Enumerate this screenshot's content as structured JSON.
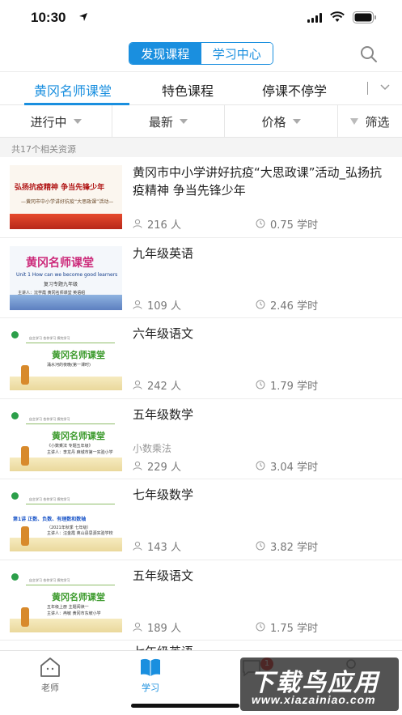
{
  "status_bar": {
    "time": "10:30"
  },
  "header": {
    "segments": [
      "发现课程",
      "学习中心"
    ],
    "active_segment": 0
  },
  "category_tabs": [
    "黄冈名师课堂",
    "特色课程",
    "停课不停学"
  ],
  "filters": {
    "status": "进行中",
    "sort": "最新",
    "price": "价格",
    "filter": "筛选"
  },
  "result_count": "共17个相关资源",
  "courses": [
    {
      "title": "黄冈市中小学讲好抗疫“大思政课”活动_弘扬抗疫精神 争当先锋少年",
      "subtitle": "",
      "learners": "216 人",
      "hours": "0.75 学时",
      "thumb": {
        "main": "弘扬抗疫精神 争当先锋少年",
        "sub": "—黄冈市中小学讲好抗疫“大思政课”活动—"
      }
    },
    {
      "title": "九年级英语",
      "subtitle": "",
      "learners": "109 人",
      "hours": "2.46 学时",
      "thumb": {
        "main": "黄冈名师课堂",
        "line1": "Unit 1  How can we  become good learners",
        "line2": "复习专题九年级",
        "line3": "主讲人：沈学霞  黄冈名师课堂 英语组"
      }
    },
    {
      "title": "六年级语文",
      "subtitle": "",
      "learners": "242 人",
      "hours": "1.79 学时",
      "thumb": {
        "top": "自主学习    合作学习    探究学习",
        "main": "黄冈名师课堂",
        "line": "涌水河的夜晚(第一课时)",
        "line2": ""
      }
    },
    {
      "title": "五年级数学",
      "subtitle": "小数乘法",
      "learners": "229 人",
      "hours": "3.04 学时",
      "thumb": {
        "top": "自主学习    合作学习    探究学习",
        "main": "黄冈名师课堂",
        "line": "《小数乘法   专题五年级》",
        "line2": "主讲人：李龙丹   麻城市第一实验小学"
      }
    },
    {
      "title": "七年级数学",
      "subtitle": "",
      "learners": "143 人",
      "hours": "3.82 学时",
      "thumb": {
        "top": "自主学习    合作学习    探究学习",
        "main": "",
        "lecture": "第1讲  正数、负数、有理数和数轴",
        "line": "（2021年秋季  七年级）",
        "line2": "主讲人：汪金霞   英山县思源实验学校"
      }
    },
    {
      "title": "五年级语文",
      "subtitle": "",
      "learners": "189 人",
      "hours": "1.75 学时",
      "thumb": {
        "top": "自主学习    合作学习    探究学习",
        "main": "黄冈名师课堂",
        "line": "五年级上册   主题阅读一",
        "line2": "主讲人：冉敏   黄冈市东坡小学"
      }
    }
  ],
  "peek_title": "七年级英语",
  "tabbar": {
    "tabs": [
      "老师",
      "学习",
      "",
      ""
    ],
    "active": 1,
    "badge": "1"
  },
  "watermark": {
    "main": "下载鸟应用",
    "url": "www.xiazainiao.com"
  },
  "colors": {
    "accent": "#1a8fdf",
    "badge": "#e53935"
  }
}
